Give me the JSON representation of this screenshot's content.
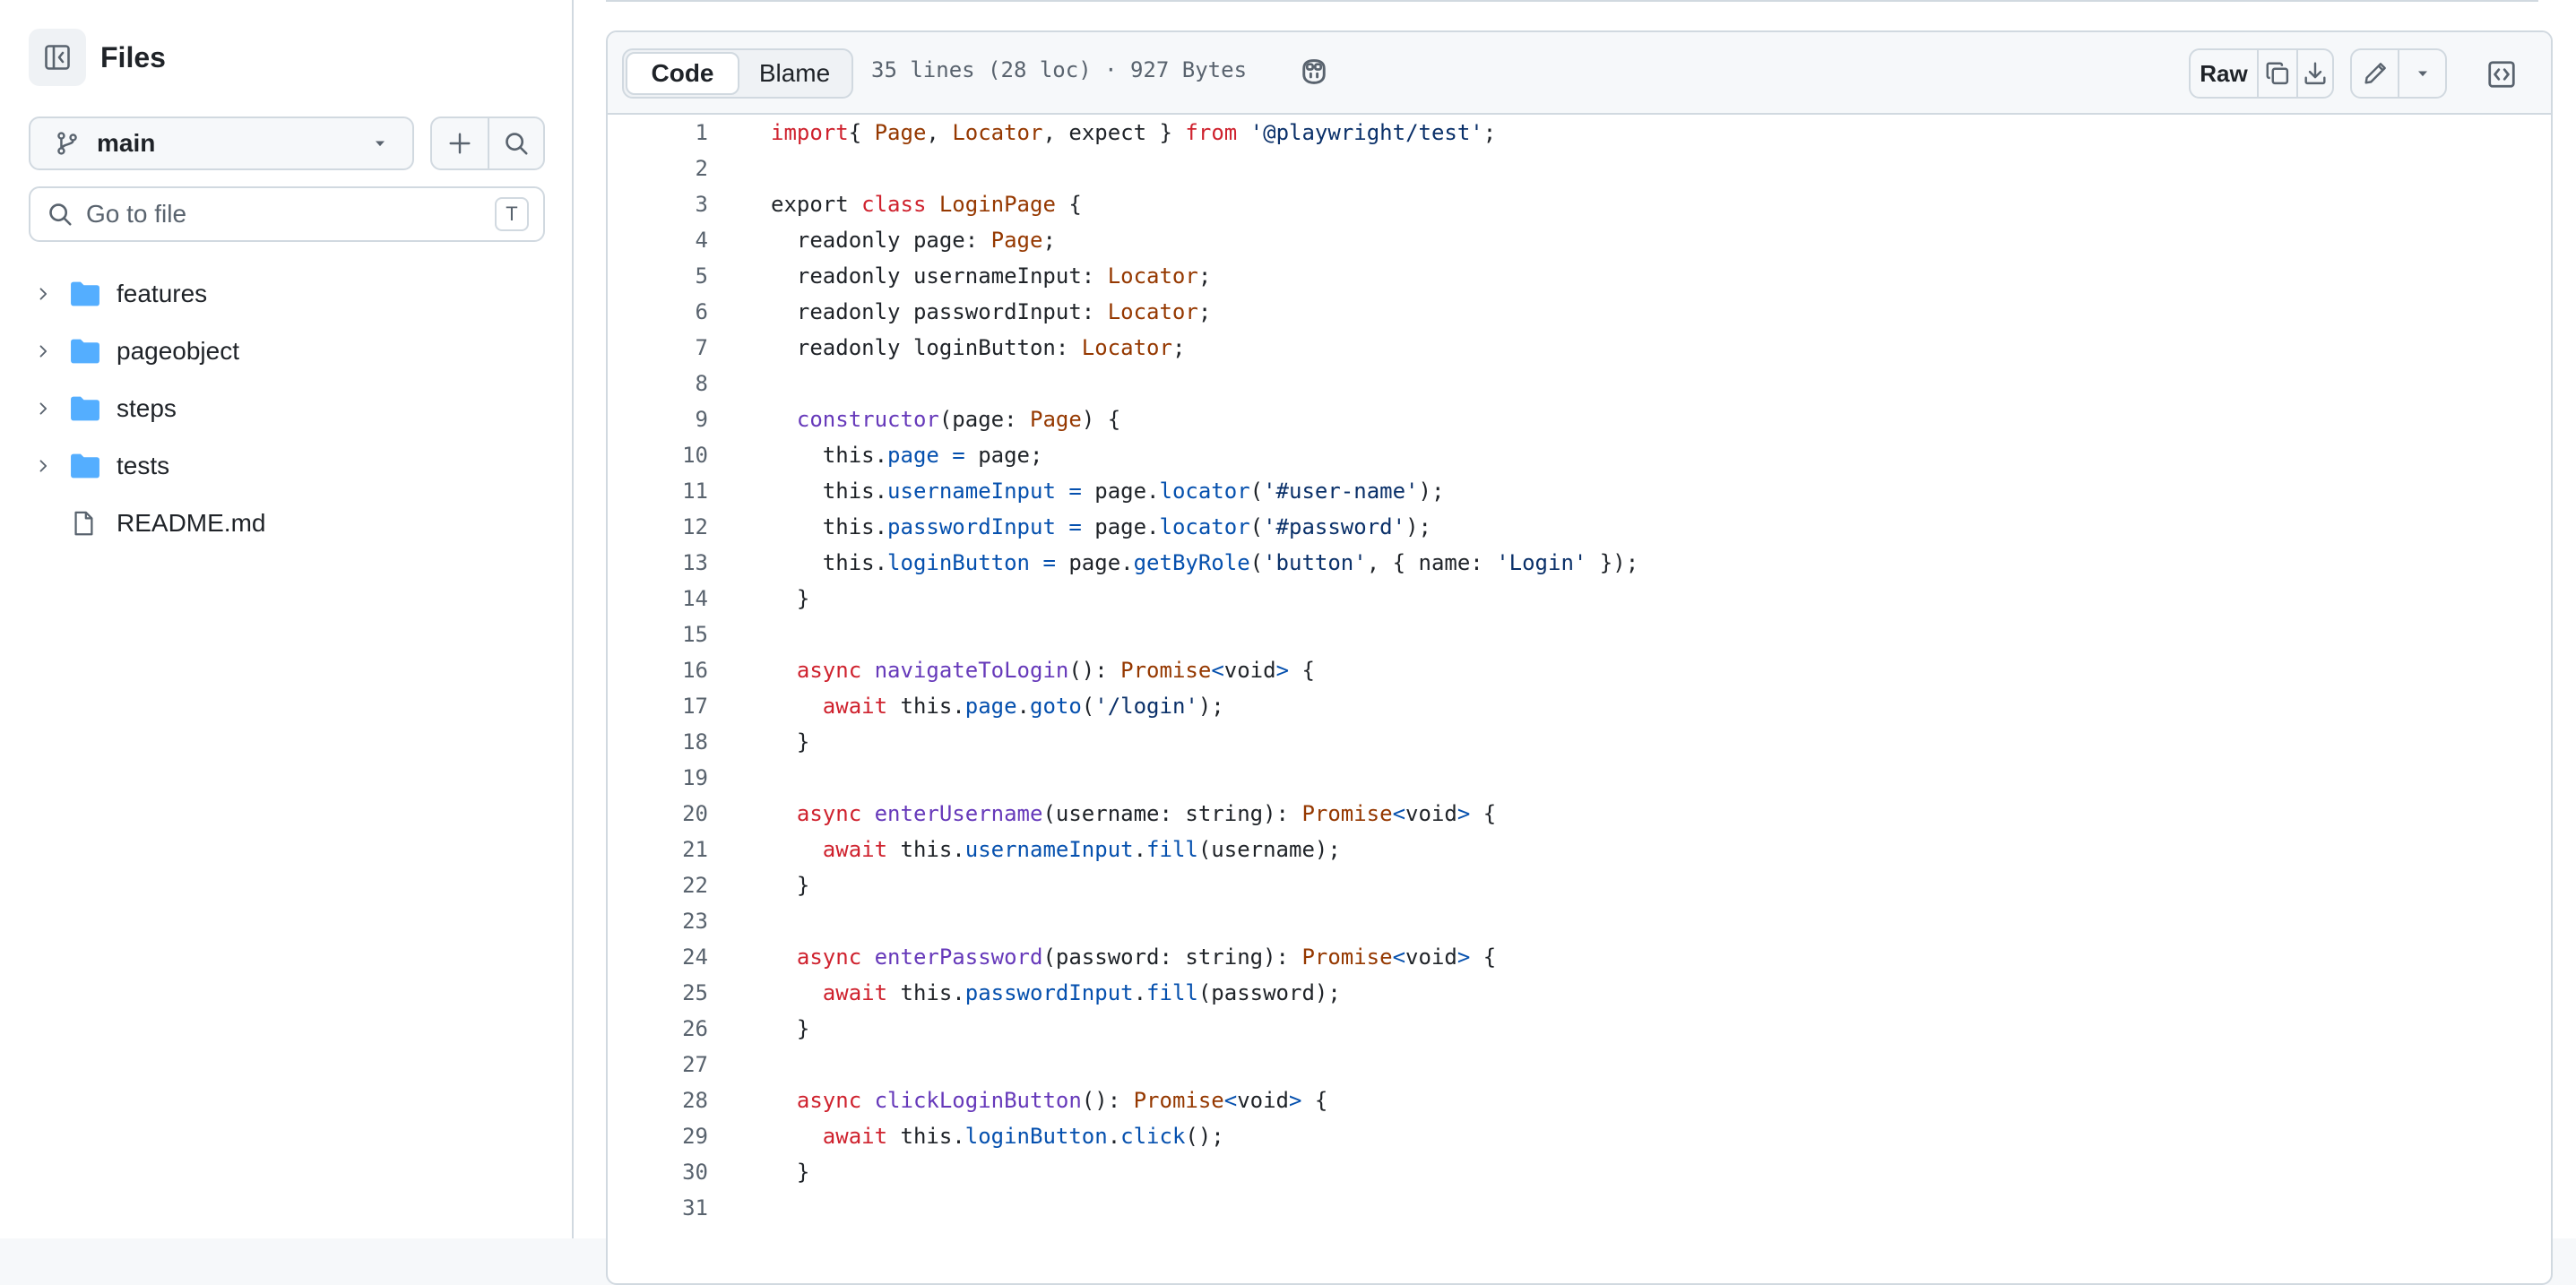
{
  "sidebar": {
    "title": "Files",
    "branch": "main",
    "search_placeholder": "Go to file",
    "shortcut": "T",
    "items": [
      {
        "label": "features",
        "type": "folder"
      },
      {
        "label": "pageobject",
        "type": "folder"
      },
      {
        "label": "steps",
        "type": "folder"
      },
      {
        "label": "tests",
        "type": "folder"
      },
      {
        "label": "README.md",
        "type": "file"
      }
    ]
  },
  "file": {
    "tabs": {
      "code": "Code",
      "blame": "Blame"
    },
    "meta": "35 lines (28 loc) · 927 Bytes",
    "raw_label": "Raw",
    "colors": {
      "keyword": "#cf222e",
      "type": "#953800",
      "string": "#0a3069",
      "function": "#6639ba",
      "property": "#0550ae"
    }
  },
  "code_lines": [
    {
      "n": "1",
      "tokens": [
        [
          "k",
          "import"
        ],
        [
          "",
          "{ "
        ],
        [
          "t",
          "Page"
        ],
        [
          "",
          ", "
        ],
        [
          "t",
          "Locator"
        ],
        [
          "",
          ", expect } "
        ],
        [
          "k",
          "from"
        ],
        [
          "",
          " "
        ],
        [
          "s",
          "'@playwright/test'"
        ],
        [
          "",
          ";"
        ]
      ]
    },
    {
      "n": "2",
      "tokens": []
    },
    {
      "n": "3",
      "tokens": [
        [
          "",
          "export "
        ],
        [
          "k",
          "class"
        ],
        [
          "",
          " "
        ],
        [
          "t",
          "LoginPage"
        ],
        [
          "",
          " {"
        ]
      ]
    },
    {
      "n": "4",
      "tokens": [
        [
          "",
          "  readonly page: "
        ],
        [
          "t",
          "Page"
        ],
        [
          "",
          ";"
        ]
      ]
    },
    {
      "n": "5",
      "tokens": [
        [
          "",
          "  readonly usernameInput: "
        ],
        [
          "t",
          "Locator"
        ],
        [
          "",
          ";"
        ]
      ]
    },
    {
      "n": "6",
      "tokens": [
        [
          "",
          "  readonly passwordInput: "
        ],
        [
          "t",
          "Locator"
        ],
        [
          "",
          ";"
        ]
      ]
    },
    {
      "n": "7",
      "tokens": [
        [
          "",
          "  readonly loginButton: "
        ],
        [
          "t",
          "Locator"
        ],
        [
          "",
          ";"
        ]
      ]
    },
    {
      "n": "8",
      "tokens": []
    },
    {
      "n": "9",
      "tokens": [
        [
          "",
          "  "
        ],
        [
          "f",
          "constructor"
        ],
        [
          "",
          "(page: "
        ],
        [
          "t",
          "Page"
        ],
        [
          "",
          ") {"
        ]
      ]
    },
    {
      "n": "10",
      "tokens": [
        [
          "",
          "    this."
        ],
        [
          "p",
          "page"
        ],
        [
          "",
          " "
        ],
        [
          "p",
          "="
        ],
        [
          "",
          " page;"
        ]
      ]
    },
    {
      "n": "11",
      "tokens": [
        [
          "",
          "    this."
        ],
        [
          "p",
          "usernameInput"
        ],
        [
          "",
          " "
        ],
        [
          "p",
          "="
        ],
        [
          "",
          " page."
        ],
        [
          "p",
          "locator"
        ],
        [
          "",
          "("
        ],
        [
          "s",
          "'#user-name'"
        ],
        [
          "",
          ");"
        ]
      ]
    },
    {
      "n": "12",
      "tokens": [
        [
          "",
          "    this."
        ],
        [
          "p",
          "passwordInput"
        ],
        [
          "",
          " "
        ],
        [
          "p",
          "="
        ],
        [
          "",
          " page."
        ],
        [
          "p",
          "locator"
        ],
        [
          "",
          "("
        ],
        [
          "s",
          "'#password'"
        ],
        [
          "",
          ");"
        ]
      ]
    },
    {
      "n": "13",
      "tokens": [
        [
          "",
          "    this."
        ],
        [
          "p",
          "loginButton"
        ],
        [
          "",
          " "
        ],
        [
          "p",
          "="
        ],
        [
          "",
          " page."
        ],
        [
          "p",
          "getByRole"
        ],
        [
          "",
          "("
        ],
        [
          "s",
          "'button'"
        ],
        [
          "",
          ", { name: "
        ],
        [
          "s",
          "'Login'"
        ],
        [
          "",
          " });"
        ]
      ]
    },
    {
      "n": "14",
      "tokens": [
        [
          "",
          "  }"
        ]
      ]
    },
    {
      "n": "15",
      "tokens": []
    },
    {
      "n": "16",
      "tokens": [
        [
          "",
          "  "
        ],
        [
          "k",
          "async"
        ],
        [
          "",
          " "
        ],
        [
          "f",
          "navigateToLogin"
        ],
        [
          "",
          "(): "
        ],
        [
          "t",
          "Promise"
        ],
        [
          "p",
          "<"
        ],
        [
          "",
          "void"
        ],
        [
          "p",
          ">"
        ],
        [
          "",
          " {"
        ]
      ]
    },
    {
      "n": "17",
      "tokens": [
        [
          "",
          "    "
        ],
        [
          "k",
          "await"
        ],
        [
          "",
          " this."
        ],
        [
          "p",
          "page"
        ],
        [
          "",
          "."
        ],
        [
          "p",
          "goto"
        ],
        [
          "",
          "("
        ],
        [
          "s",
          "'/login'"
        ],
        [
          "",
          ");"
        ]
      ]
    },
    {
      "n": "18",
      "tokens": [
        [
          "",
          "  }"
        ]
      ]
    },
    {
      "n": "19",
      "tokens": []
    },
    {
      "n": "20",
      "tokens": [
        [
          "",
          "  "
        ],
        [
          "k",
          "async"
        ],
        [
          "",
          " "
        ],
        [
          "f",
          "enterUsername"
        ],
        [
          "",
          "(username: string): "
        ],
        [
          "t",
          "Promise"
        ],
        [
          "p",
          "<"
        ],
        [
          "",
          "void"
        ],
        [
          "p",
          ">"
        ],
        [
          "",
          " {"
        ]
      ]
    },
    {
      "n": "21",
      "tokens": [
        [
          "",
          "    "
        ],
        [
          "k",
          "await"
        ],
        [
          "",
          " this."
        ],
        [
          "p",
          "usernameInput"
        ],
        [
          "",
          "."
        ],
        [
          "p",
          "fill"
        ],
        [
          "",
          "(username);"
        ]
      ]
    },
    {
      "n": "22",
      "tokens": [
        [
          "",
          "  }"
        ]
      ]
    },
    {
      "n": "23",
      "tokens": []
    },
    {
      "n": "24",
      "tokens": [
        [
          "",
          "  "
        ],
        [
          "k",
          "async"
        ],
        [
          "",
          " "
        ],
        [
          "f",
          "enterPassword"
        ],
        [
          "",
          "(password: string): "
        ],
        [
          "t",
          "Promise"
        ],
        [
          "p",
          "<"
        ],
        [
          "",
          "void"
        ],
        [
          "p",
          ">"
        ],
        [
          "",
          " {"
        ]
      ]
    },
    {
      "n": "25",
      "tokens": [
        [
          "",
          "    "
        ],
        [
          "k",
          "await"
        ],
        [
          "",
          " this."
        ],
        [
          "p",
          "passwordInput"
        ],
        [
          "",
          "."
        ],
        [
          "p",
          "fill"
        ],
        [
          "",
          "(password);"
        ]
      ]
    },
    {
      "n": "26",
      "tokens": [
        [
          "",
          "  }"
        ]
      ]
    },
    {
      "n": "27",
      "tokens": []
    },
    {
      "n": "28",
      "tokens": [
        [
          "",
          "  "
        ],
        [
          "k",
          "async"
        ],
        [
          "",
          " "
        ],
        [
          "f",
          "clickLoginButton"
        ],
        [
          "",
          "(): "
        ],
        [
          "t",
          "Promise"
        ],
        [
          "p",
          "<"
        ],
        [
          "",
          "void"
        ],
        [
          "p",
          ">"
        ],
        [
          "",
          " {"
        ]
      ]
    },
    {
      "n": "29",
      "tokens": [
        [
          "",
          "    "
        ],
        [
          "k",
          "await"
        ],
        [
          "",
          " this."
        ],
        [
          "p",
          "loginButton"
        ],
        [
          "",
          "."
        ],
        [
          "p",
          "click"
        ],
        [
          "",
          "();"
        ]
      ]
    },
    {
      "n": "30",
      "tokens": [
        [
          "",
          "  }"
        ]
      ]
    },
    {
      "n": "31",
      "tokens": []
    }
  ]
}
